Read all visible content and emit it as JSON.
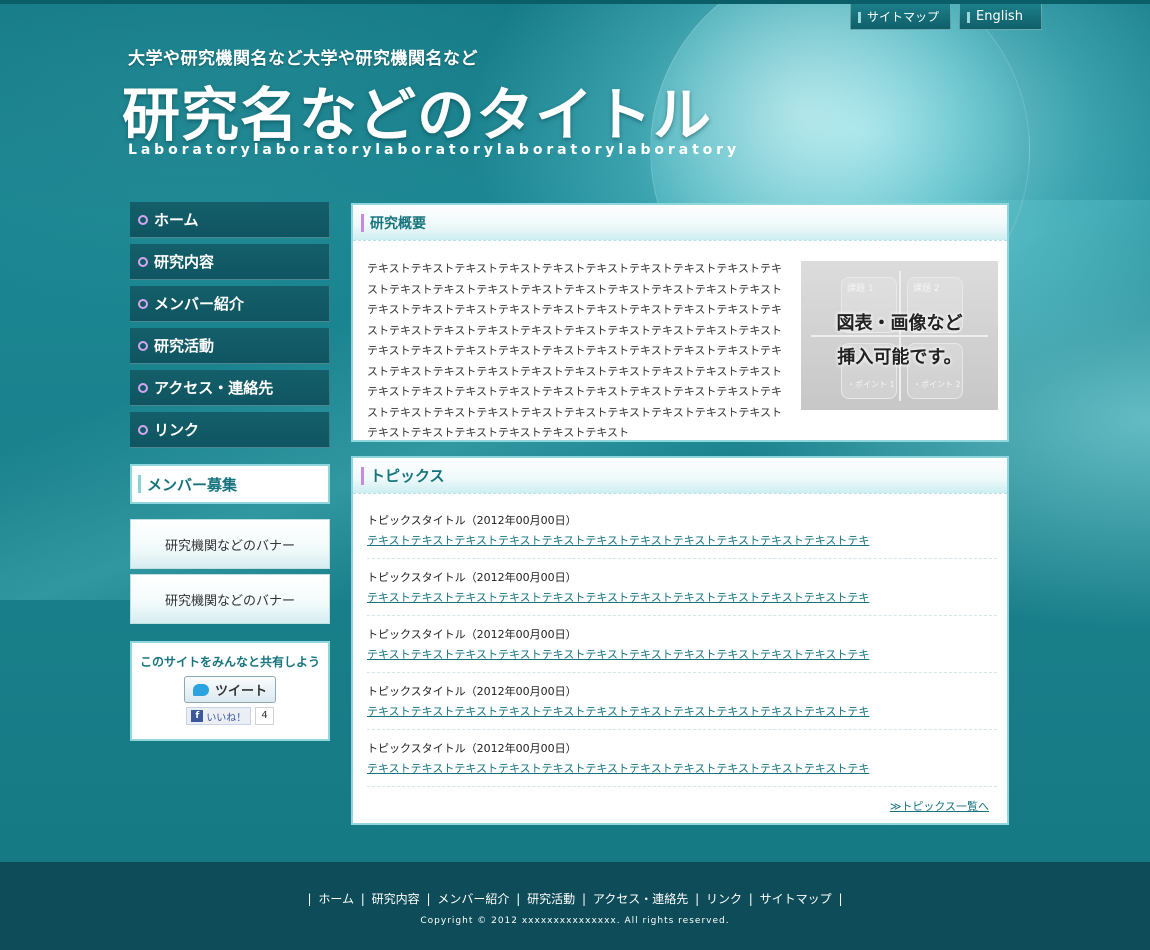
{
  "header": {
    "subtitle": "大学や研究機関名など大学や研究機関名など",
    "title": "研究名などのタイトル",
    "lab": "Laboratorylaboratorylaboratorylaboratorylaboratory",
    "links": [
      {
        "label": "サイトマップ"
      },
      {
        "label": "English"
      }
    ]
  },
  "sidebar": {
    "items": [
      {
        "label": "ホーム"
      },
      {
        "label": "研究内容"
      },
      {
        "label": "メンバー紹介"
      },
      {
        "label": "研究活動"
      },
      {
        "label": "アクセス・連絡先"
      },
      {
        "label": "リンク"
      }
    ],
    "recruit": "メンバー募集",
    "banners": [
      "研究機関などのバナー",
      "研究機関などのバナー"
    ],
    "share": {
      "title": "このサイトをみんなと共有しよう",
      "tweet": "ツイート",
      "like": "いいね！",
      "like_count": "4"
    }
  },
  "overview": {
    "heading": "研究概要",
    "text": "テキストテキストテキストテキストテキストテキストテキストテキストテキストテキストテキストテキストテキストテキストテキストテキストテキストテキストテキストテキストテキストテキストテキストテキストテキストテキストテキストテキストテキストテキストテキストテキストテキストテキストテキストテキストテキストテキストテキストテキストテキストテキストテキストテキストテキストテキストテキストテキストテキストテキストテキストテキストテキストテキストテキストテキストテキストテキストテキストテキストテキストテキストテキストテキストテキストテキストテキストテキストテキストテキストテキストテキストテキストテキストテキストテキストテキストテキストテキストテキストテキストテキスト",
    "figure": {
      "line1": "図表・画像など",
      "line2": "挿入可能です。",
      "labels": [
        "課題 1",
        "課題 2",
        "・ポイント 1",
        "・ポイント 2"
      ]
    }
  },
  "topics": {
    "heading": "トピックス",
    "items": [
      {
        "title": "トピックスタイトル（2012年00月00日）",
        "text": "テキストテキストテキストテキストテキストテキストテキストテキストテキストテキストテキストテキ"
      },
      {
        "title": "トピックスタイトル（2012年00月00日）",
        "text": "テキストテキストテキストテキストテキストテキストテキストテキストテキストテキストテキストテキ"
      },
      {
        "title": "トピックスタイトル（2012年00月00日）",
        "text": "テキストテキストテキストテキストテキストテキストテキストテキストテキストテキストテキストテキ"
      },
      {
        "title": "トピックスタイトル（2012年00月00日）",
        "text": "テキストテキストテキストテキストテキストテキストテキストテキストテキストテキストテキストテキ"
      },
      {
        "title": "トピックスタイトル（2012年00月00日）",
        "text": "テキストテキストテキストテキストテキストテキストテキストテキストテキストテキストテキストテキ"
      }
    ],
    "more": "≫トピックス一覧へ"
  },
  "footer": {
    "links": [
      "ホーム",
      "研究内容",
      "メンバー紹介",
      "研究活動",
      "アクセス・連絡先",
      "リンク",
      "サイトマップ"
    ],
    "copyright": "Copyright © 2012 xxxxxxxxxxxxxxx. All rights reserved."
  }
}
